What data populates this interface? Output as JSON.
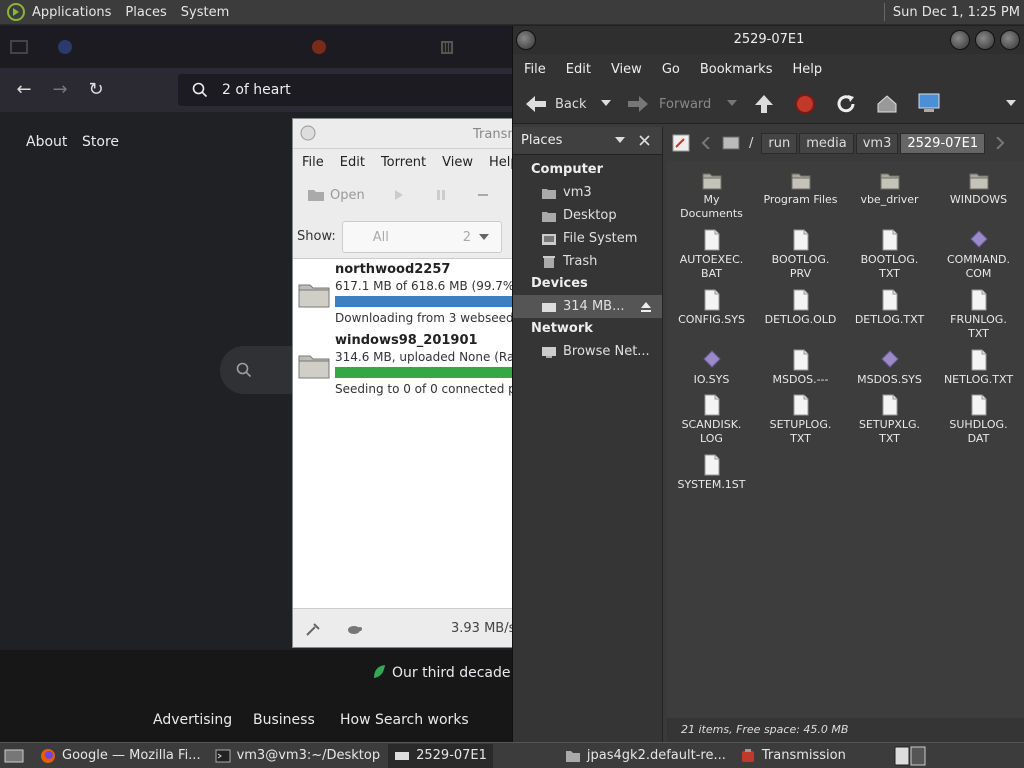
{
  "top_panel": {
    "menus": [
      "Applications",
      "Places",
      "System"
    ],
    "clock": "Sun Dec 1,  1:25 PM"
  },
  "firefox": {
    "url_text": "2 of heart",
    "links": {
      "about": "About",
      "store": "Store"
    },
    "footer": {
      "tagline": "Our third decade of",
      "advertising": "Advertising",
      "business": "Business",
      "how_search": "How Search works"
    }
  },
  "transmission": {
    "title": "Transm",
    "menu": [
      "File",
      "Edit",
      "Torrent",
      "View",
      "Help"
    ],
    "toolbar": {
      "open": "Open"
    },
    "filter": {
      "label": "Show:",
      "value": "All",
      "count": "2"
    },
    "torrents": [
      {
        "name": "northwood2257",
        "info": "617.1 MB of 618.6 MB (99.7%) - ne",
        "status": "Downloading from 3 webseeds -",
        "progress": 0.997,
        "color": "#3d7fc1"
      },
      {
        "name": "windows98_201901",
        "info": "314.6 MB, uploaded None (Ratio:",
        "status": "Seeding to 0 of 0 connected peers",
        "progress": 1.0,
        "color": "#34a843"
      }
    ],
    "speed": "3.93 MB/s"
  },
  "caja": {
    "title": "2529-07E1",
    "menu": [
      "File",
      "Edit",
      "View",
      "Go",
      "Bookmarks",
      "Help"
    ],
    "toolbar": {
      "back": "Back",
      "forward": "Forward"
    },
    "sidebar": {
      "header": "Places",
      "sections": {
        "computer": "Computer",
        "devices": "Devices",
        "network": "Network"
      },
      "computer_items": [
        "vm3",
        "Desktop",
        "File System",
        "Trash"
      ],
      "device_items": [
        "314 MB..."
      ],
      "network_items": [
        "Browse Net..."
      ]
    },
    "path": [
      "/",
      "run",
      "media",
      "vm3",
      "2529-07E1"
    ],
    "files": [
      {
        "name": "My\nDocuments",
        "type": "folder"
      },
      {
        "name": "Program Files",
        "type": "folder"
      },
      {
        "name": "vbe_driver",
        "type": "folder"
      },
      {
        "name": "WINDOWS",
        "type": "folder"
      },
      {
        "name": "AUTOEXEC.\nBAT",
        "type": "file"
      },
      {
        "name": "BOOTLOG.\nPRV",
        "type": "file"
      },
      {
        "name": "BOOTLOG.\nTXT",
        "type": "file"
      },
      {
        "name": "COMMAND.\nCOM",
        "type": "exec"
      },
      {
        "name": "CONFIG.SYS",
        "type": "file"
      },
      {
        "name": "DETLOG.OLD",
        "type": "file"
      },
      {
        "name": "DETLOG.TXT",
        "type": "file"
      },
      {
        "name": "FRUNLOG.\nTXT",
        "type": "file"
      },
      {
        "name": "IO.SYS",
        "type": "exec"
      },
      {
        "name": "MSDOS.---",
        "type": "file"
      },
      {
        "name": "MSDOS.SYS",
        "type": "exec"
      },
      {
        "name": "NETLOG.TXT",
        "type": "file"
      },
      {
        "name": "SCANDISK.\nLOG",
        "type": "file"
      },
      {
        "name": "SETUPLOG.\nTXT",
        "type": "file"
      },
      {
        "name": "SETUPXLG.\nTXT",
        "type": "file"
      },
      {
        "name": "SUHDLOG.\nDAT",
        "type": "file"
      },
      {
        "name": "SYSTEM.1ST",
        "type": "file"
      }
    ],
    "status": "21 items, Free space: 45.0 MB"
  },
  "taskbar": {
    "tasks": [
      {
        "label": "Google — Mozilla Fi...",
        "icon": "firefox-icon"
      },
      {
        "label": "vm3@vm3:~/Desktop",
        "icon": "terminal-icon"
      },
      {
        "label": "2529-07E1",
        "icon": "drive-icon"
      },
      {
        "label": "jpas4gk2.default-re...",
        "icon": "folder-icon"
      },
      {
        "label": "Transmission",
        "icon": "transmission-icon"
      }
    ]
  }
}
